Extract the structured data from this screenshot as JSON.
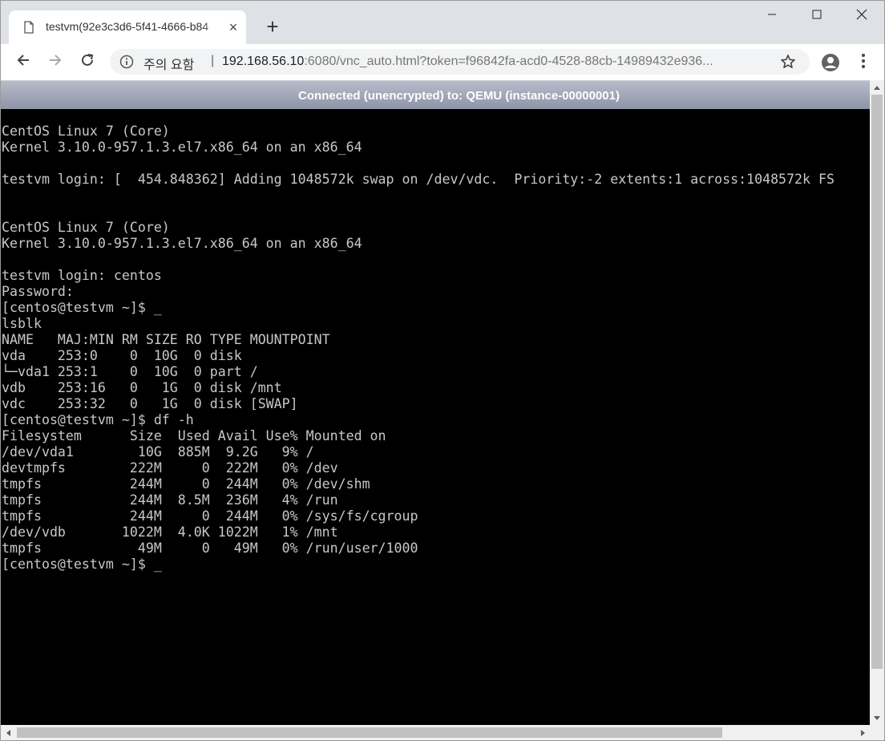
{
  "browser": {
    "tab_title": "testvm(92e3c3d6-5f41-4666-b84",
    "tab_icon": "document-icon",
    "new_tab_label": "+",
    "close_tab_label": "×",
    "security_label": "주의 요함",
    "separator": "|",
    "url_host": "192.168.56.10",
    "url_rest": ":6080/vnc_auto.html?token=f96842fa-acd0-4528-88cb-14989432e936",
    "url_ellipsis": "...",
    "icons": {
      "back": "back-arrow-icon",
      "forward": "forward-arrow-icon",
      "reload": "reload-icon",
      "info": "info-icon",
      "bookmark": "star-icon",
      "profile": "profile-icon",
      "menu": "kebab-menu-icon",
      "minimize": "minimize-icon",
      "maximize": "maximize-icon",
      "close": "close-icon"
    }
  },
  "vnc": {
    "status": "Connected (unencrypted) to: QEMU (instance-00000001)",
    "colors": {
      "status_bar": "#8b93a6",
      "terminal_bg": "#000000",
      "terminal_fg": "#c8c8c8"
    }
  },
  "terminal": {
    "lines": [
      "CentOS Linux 7 (Core)",
      "Kernel 3.10.0-957.1.3.el7.x86_64 on an x86_64",
      "",
      "testvm login: [  454.848362] Adding 1048572k swap on /dev/vdc.  Priority:-2 extents:1 across:1048572k FS",
      "",
      "",
      "CentOS Linux 7 (Core)",
      "Kernel 3.10.0-957.1.3.el7.x86_64 on an x86_64",
      "",
      "testvm login: centos",
      "Password:",
      "[centos@testvm ~]$ _",
      "lsblk",
      "NAME   MAJ:MIN RM SIZE RO TYPE MOUNTPOINT",
      "vda    253:0    0  10G  0 disk",
      "└─vda1 253:1    0  10G  0 part /",
      "vdb    253:16   0   1G  0 disk /mnt",
      "vdc    253:32   0   1G  0 disk [SWAP]",
      "[centos@testvm ~]$ df -h",
      "Filesystem      Size  Used Avail Use% Mounted on",
      "/dev/vda1        10G  885M  9.2G   9% /",
      "devtmpfs        222M     0  222M   0% /dev",
      "tmpfs           244M     0  244M   0% /dev/shm",
      "tmpfs           244M  8.5M  236M   4% /run",
      "tmpfs           244M     0  244M   0% /sys/fs/cgroup",
      "/dev/vdb       1022M  4.0K 1022M   1% /mnt",
      "tmpfs            49M     0   49M   0% /run/user/1000"
    ],
    "prompt": "[centos@testvm ~]$ ",
    "cursor": "_"
  }
}
